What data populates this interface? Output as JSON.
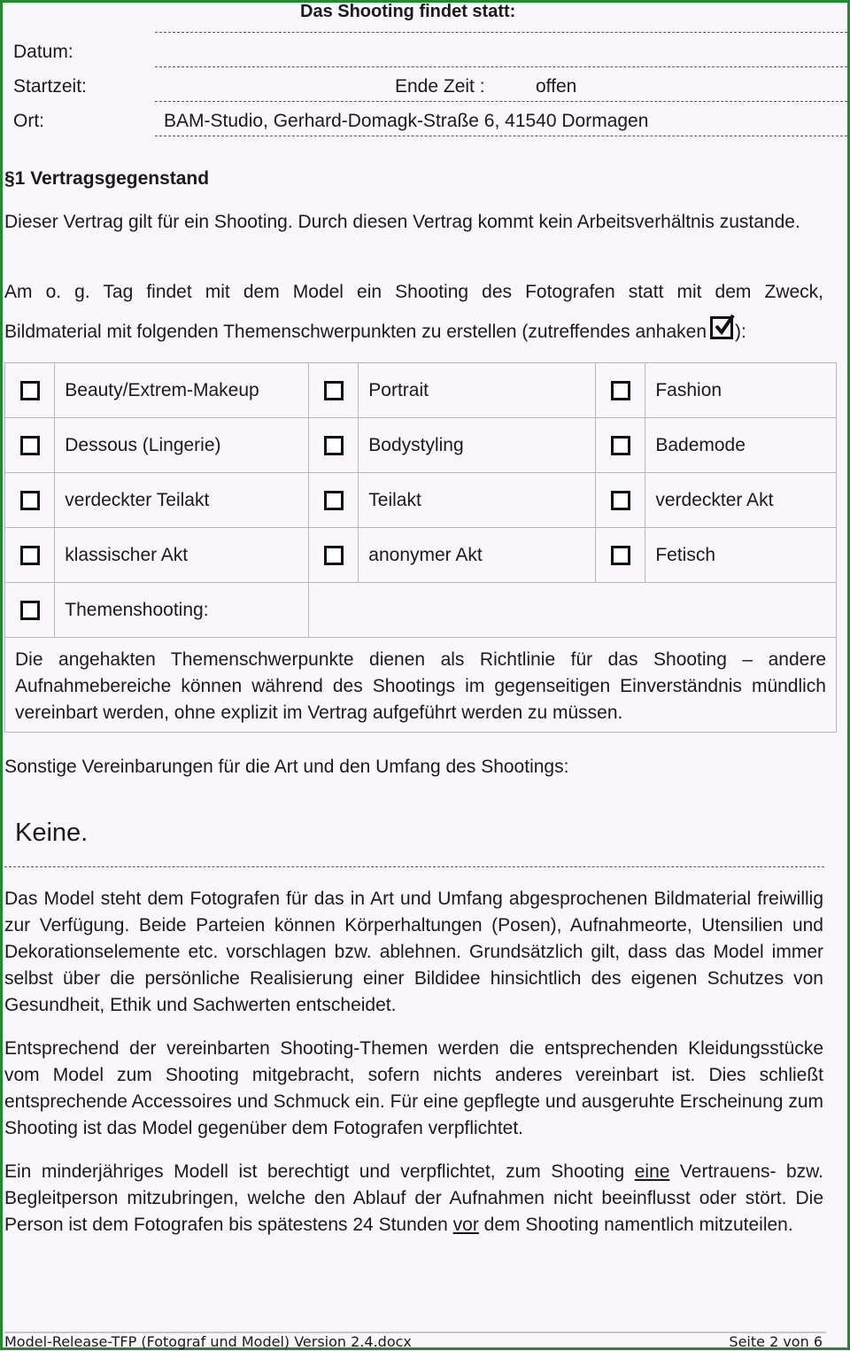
{
  "header": {
    "title": "Das Shooting findet statt:"
  },
  "fields": {
    "datum_label": "Datum:",
    "datum_value": "",
    "startzeit_label": "Startzeit:",
    "startzeit_value": "",
    "ende_label": "Ende Zeit :",
    "ende_value": "offen",
    "ort_label": "Ort:",
    "ort_value": "BAM-Studio, Gerhard-Domagk-Straße 6, 41540 Dormagen"
  },
  "section1": {
    "title": "§1 Vertragsgegenstand",
    "para1": "Dieser Vertrag gilt für ein Shooting. Durch diesen Vertrag kommt kein Arbeitsverhältnis zustande.",
    "para2_line1": "Am o. g. Tag findet mit dem Model ein Shooting des Fotografen statt mit dem Zweck,",
    "para2_line2": "Bildmaterial mit folgenden Themenschwerpunkten zu erstellen (zutreffendes anhaken",
    "para2_end": "):"
  },
  "themes": {
    "rows": [
      [
        {
          "label": "Beauty/Extrem-Makeup",
          "checked": false
        },
        {
          "label": "Portrait",
          "checked": false
        },
        {
          "label": "Fashion",
          "checked": false
        }
      ],
      [
        {
          "label": "Dessous (Lingerie)",
          "checked": false
        },
        {
          "label": "Bodystyling",
          "checked": false
        },
        {
          "label": "Bademode",
          "checked": false
        }
      ],
      [
        {
          "label": "verdeckter Teilakt",
          "checked": false
        },
        {
          "label": "Teilakt",
          "checked": false
        },
        {
          "label": "verdeckter Akt",
          "checked": false
        }
      ],
      [
        {
          "label": "klassischer Akt",
          "checked": false
        },
        {
          "label": "anonymer Akt",
          "checked": false
        },
        {
          "label": "Fetisch",
          "checked": false
        }
      ]
    ],
    "themenshooting": {
      "label": "Themenshooting:",
      "checked": false,
      "value": ""
    },
    "note": "Die angehakten Themenschwerpunkte dienen als Richtlinie für das Shooting – andere Aufnahmebereiche können während des Shootings im gegenseitigen Einverständnis mündlich vereinbart werden, ohne explizit im Vertrag aufgeführt werden zu müssen."
  },
  "other_agreements": {
    "label": "Sonstige Vereinbarungen für die Art und den Umfang des Shootings:",
    "value": "Keine."
  },
  "paragraphs": {
    "p1": "Das Model steht dem Fotografen für das in Art und Umfang abgesprochenen Bildmaterial freiwillig zur Verfügung. Beide Parteien können Körperhaltungen (Posen), Aufnahmeorte, Utensilien und Dekorationselemente etc. vorschlagen bzw. ablehnen. Grundsätzlich gilt, dass das Model immer selbst über die persönliche Realisierung einer Bildidee hinsichtlich des eigenen Schutzes von Gesundheit, Ethik und Sachwerten entscheidet.",
    "p2": "Entsprechend der vereinbarten Shooting-Themen werden die entsprechenden Kleidungsstücke vom Model zum Shooting mitgebracht, sofern nichts anderes vereinbart ist. Dies schließt entsprechende Accessoires und Schmuck ein. Für eine gepflegte und ausgeruhte Erscheinung zum Shooting ist das Model gegenüber dem Fotografen verpflichtet.",
    "p3_a": "Ein minderjähriges Modell ist berechtigt und verpflichtet, zum Shooting ",
    "p3_u1": "eine",
    "p3_b": " Vertrauens- bzw. Begleitperson mitzubringen, welche den Ablauf der Aufnahmen nicht beeinflusst oder stört. Die Person ist dem Fotografen bis spätestens 24 Stunden ",
    "p3_u2": "vor",
    "p3_c": " dem Shooting namentlich mitzuteilen."
  },
  "footer": {
    "filename": "Model-Release-TFP (Fotograf und Model) Version 2.4.docx",
    "page": "Seite 2 von 6"
  },
  "colors": {
    "frame": "#1f8a2e",
    "page_bg": "#f9f7fb",
    "text": "#1a1a1a",
    "table_border": "#b9b6bd"
  }
}
